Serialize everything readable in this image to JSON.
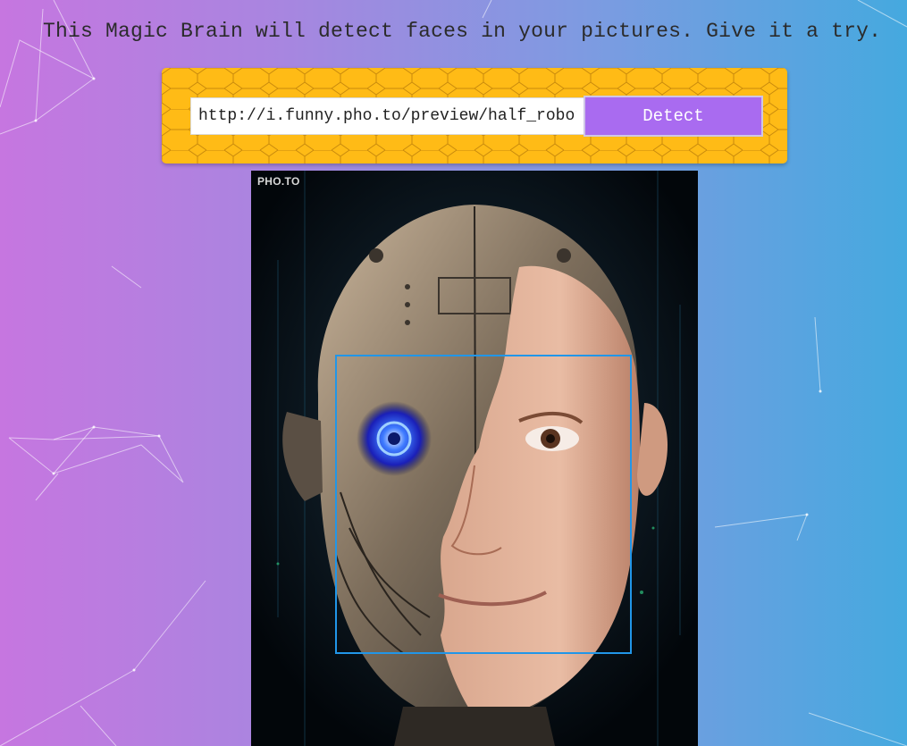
{
  "header": {
    "tagline": "This Magic Brain will detect faces in your pictures. Give it a try."
  },
  "form": {
    "url_value": "http://i.funny.pho.to/preview/half_robot_face.jpg",
    "detect_label": "Detect"
  },
  "image": {
    "watermark": "PHO.TO"
  },
  "detection": {
    "faces_detected": 1
  },
  "colors": {
    "panel": "#ffbb16",
    "button": "#a96bf0",
    "face_box": "#2196e8",
    "bg_left": "#c676e0",
    "bg_right": "#45a9df"
  }
}
